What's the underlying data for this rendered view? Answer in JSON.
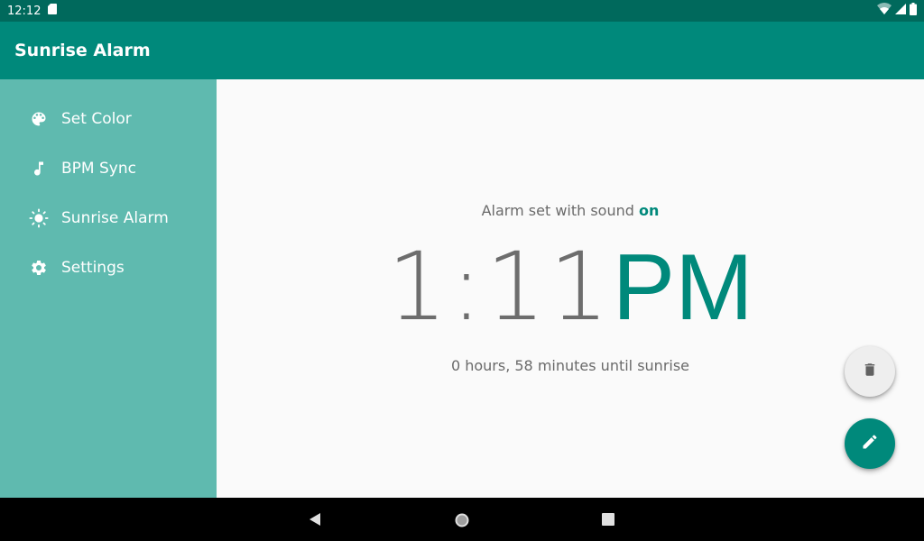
{
  "status_bar": {
    "time": "12:12",
    "icons": [
      "sd-card-icon",
      "wifi-icon",
      "signal-icon",
      "battery-icon"
    ]
  },
  "app_bar": {
    "title": "Sunrise Alarm"
  },
  "sidebar": {
    "items": [
      {
        "label": "Set Color",
        "icon": "palette-icon"
      },
      {
        "label": "BPM Sync",
        "icon": "music-note-icon"
      },
      {
        "label": "Sunrise Alarm",
        "icon": "sun-icon"
      },
      {
        "label": "Settings",
        "icon": "gear-icon"
      }
    ]
  },
  "alarm": {
    "sound_prefix": "Alarm set with sound ",
    "sound_state": "on",
    "time": "1:11",
    "period": "PM",
    "countdown": "0 hours, 58 minutes until sunrise"
  },
  "actions": {
    "delete_icon": "trash-icon",
    "edit_icon": "pencil-icon"
  },
  "nav_bar": {
    "buttons": [
      "back-icon",
      "home-icon",
      "recents-icon"
    ]
  },
  "colors": {
    "status_bar": "#00695c",
    "app_bar": "#00897b",
    "sidebar": "#5fbaaf",
    "accent": "#00897b",
    "background": "#fafafa"
  }
}
